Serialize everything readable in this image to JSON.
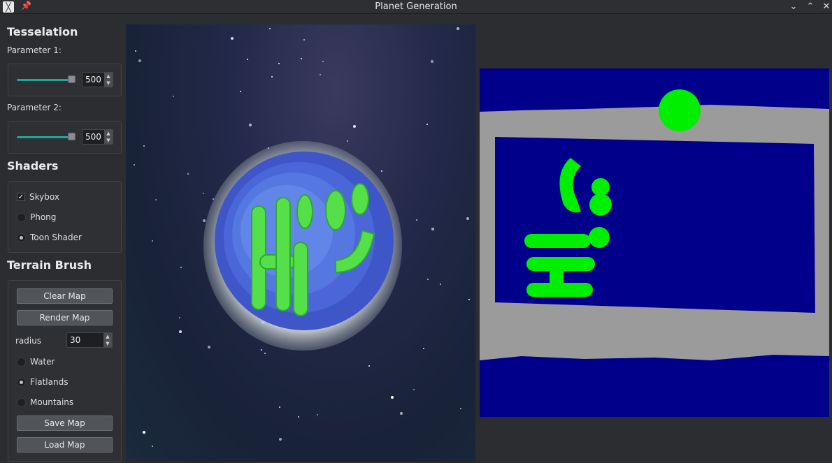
{
  "window": {
    "title": "Planet Generation",
    "app_icon_glyph": "╳",
    "pin_icon": "pin-icon",
    "buttons": [
      "minimize",
      "maximize",
      "close"
    ]
  },
  "tesselation": {
    "title": "Tesselation",
    "param1": {
      "label": "Parameter 1:",
      "value": "500",
      "fill": 1.0
    },
    "param2": {
      "label": "Parameter 2:",
      "value": "500",
      "fill": 1.0
    }
  },
  "shaders": {
    "title": "Shaders",
    "skybox": {
      "label": "Skybox",
      "checked": true
    },
    "options": [
      {
        "label": "Phong",
        "selected": false
      },
      {
        "label": "Toon Shader",
        "selected": true
      }
    ]
  },
  "terrain": {
    "title": "Terrain Brush",
    "clear_label": "Clear Map",
    "render_label": "Render Map",
    "radius_label": "radius",
    "radius_value": "30",
    "brushes": [
      {
        "label": "Water",
        "selected": false
      },
      {
        "label": "Flatlands",
        "selected": true
      },
      {
        "label": "Mountains",
        "selected": false
      }
    ],
    "save_label": "Save Map",
    "load_label": "Load Map"
  },
  "colors": {
    "accent": "#1fa89a",
    "water": "#00008b",
    "mountain": "#9a9a9a",
    "flatland": "#00ee00"
  }
}
